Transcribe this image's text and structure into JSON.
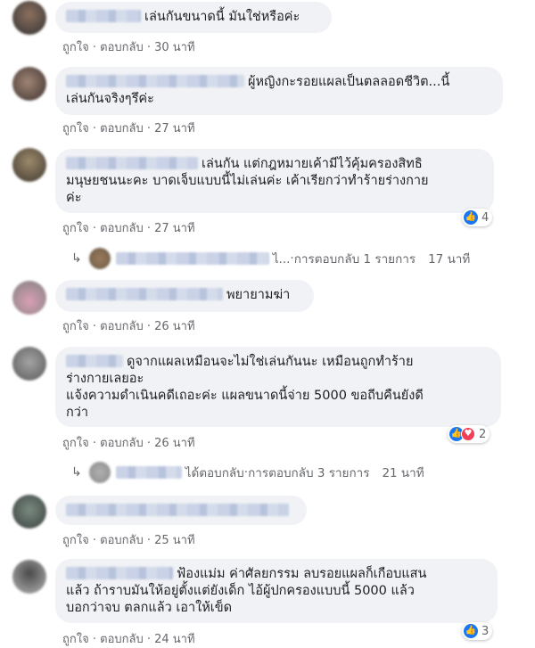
{
  "actions": {
    "like": "ถูกใจ",
    "sep": " · ",
    "reply": "ตอบกลับ"
  },
  "comments": [
    {
      "text": "เล่นกันขนาดนี้ มันใช่หรือค่ะ",
      "time": "30 นาที"
    },
    {
      "text_1": "ผู้หญิงกะรอยแผลเป็นตลลอดชีวิต...นี้",
      "text_2": "เล่นกันจริงๆรึค่ะ",
      "time": "27 นาที"
    },
    {
      "text_1": "เล่นกัน แต่กฎหมายเค้ามีไว้คุ้มครองสิทธิ",
      "text_2": "มนุษยชนนะคะ บาดเจ็บแบบนี้ไม่เล่นค่ะ เค้าเรียกว่าทำร้ายร่างกาย",
      "text_3": "ค่ะ",
      "time": "27 นาที",
      "reactions": "4"
    },
    {
      "text": "พยายามฆ่า",
      "time": "26 นาที"
    },
    {
      "text_1": "ดูจากแผลเหมือนจะไม่ใช่เล่นกันนะ เหมือนถูกทำร้าย",
      "text_2": "ร่างกายเลยอะ",
      "text_3": "แจ้งความดำเนินคดีเถอะค่ะ แผลขนาดนี้จ่าย 5000 ขอถีบคืนยังดี",
      "text_4": "กว่า",
      "time": "26 นาที",
      "reactions": "2"
    },
    {
      "time": "25 นาที"
    },
    {
      "text_1": "ฟ้องแม่ม ค่าศัลยกรรม ลบรอยแผลก็เกือบแสน",
      "text_2": "แล้ว ถ้าราบมันให้อยู่ตั้งแต่ยังเด็ก ไอ้ผู้ปกครองแบบนี้ 5000 แล้ว",
      "text_3": "บอกว่าจบ ตลกแล้ว เอาให้เข็ด",
      "time": "24 นาที",
      "reactions": "3"
    }
  ],
  "replies": [
    {
      "text": "ไ...",
      "sep": " · ",
      "count": "การตอบกลับ 1 รายการ",
      "time": "17 นาที"
    },
    {
      "text": "ได้ตอบกลับ",
      "sep": " · ",
      "count": "การตอบกลับ 3 รายการ",
      "time": "21 นาที"
    }
  ],
  "colors": {
    "bubble": "#f0f2f5",
    "meta": "#65676b",
    "like": "#1877f2",
    "love": "#f33e58"
  }
}
